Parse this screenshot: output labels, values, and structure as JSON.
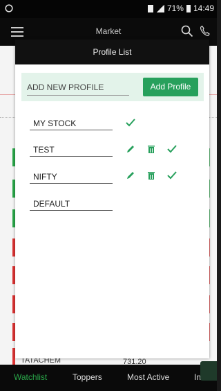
{
  "status_bar": {
    "battery": "71%",
    "time": "14:49"
  },
  "appbar": {
    "title": "Market"
  },
  "dialog": {
    "title": "Profile List",
    "add_placeholder": "ADD NEW PROFILE",
    "add_button": "Add Profile",
    "profiles": [
      {
        "name": "MY STOCK",
        "editable": false
      },
      {
        "name": "TEST",
        "editable": true
      },
      {
        "name": "NIFTY",
        "editable": true
      },
      {
        "name": "DEFAULT",
        "editable": false
      }
    ]
  },
  "background_row": {
    "symbol": "TATACHEM",
    "price": "731.20"
  },
  "tabs": [
    "Watchlist",
    "Toppers",
    "Most Active",
    "Indices"
  ],
  "colors": {
    "accent": "#27a05c",
    "header": "#111111",
    "up": "#2aa84a",
    "down": "#dd3333"
  }
}
